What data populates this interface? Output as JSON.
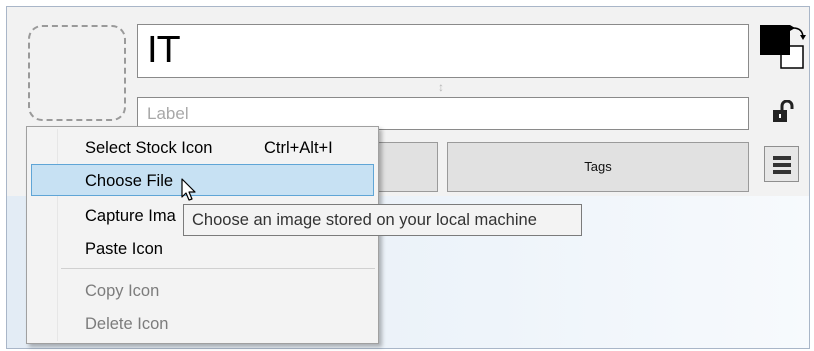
{
  "editor": {
    "title_value": "IT",
    "label_placeholder": "Label",
    "tags_button_label": "Tags",
    "left_button_label": "",
    "resize_glyph": "↕"
  },
  "icons": {
    "color_swatch": "foreground-background-swap-icon",
    "lock": "unlocked-padlock-icon",
    "menu": "hamburger-menu-icon",
    "cursor": "mouse-pointer-icon"
  },
  "context_menu": {
    "items": [
      {
        "label": "Select Stock Icon",
        "shortcut": "Ctrl+Alt+I",
        "enabled": true
      },
      {
        "label": "Choose File",
        "shortcut": "",
        "enabled": true,
        "highlighted": true
      },
      {
        "label": "Capture Ima",
        "shortcut": "",
        "enabled": true
      },
      {
        "label": "Paste Icon",
        "shortcut": "",
        "enabled": true
      },
      {
        "label": "Copy Icon",
        "shortcut": "",
        "enabled": false
      },
      {
        "label": "Delete Icon",
        "shortcut": "",
        "enabled": false
      }
    ]
  },
  "tooltip": {
    "text": "Choose an image stored on your local machine"
  },
  "colors": {
    "highlight_bg": "#c7e1f3",
    "highlight_border": "#5fa5d6",
    "panel_bg": "#f2f2f2",
    "disabled_text": "#7c7c7c"
  }
}
